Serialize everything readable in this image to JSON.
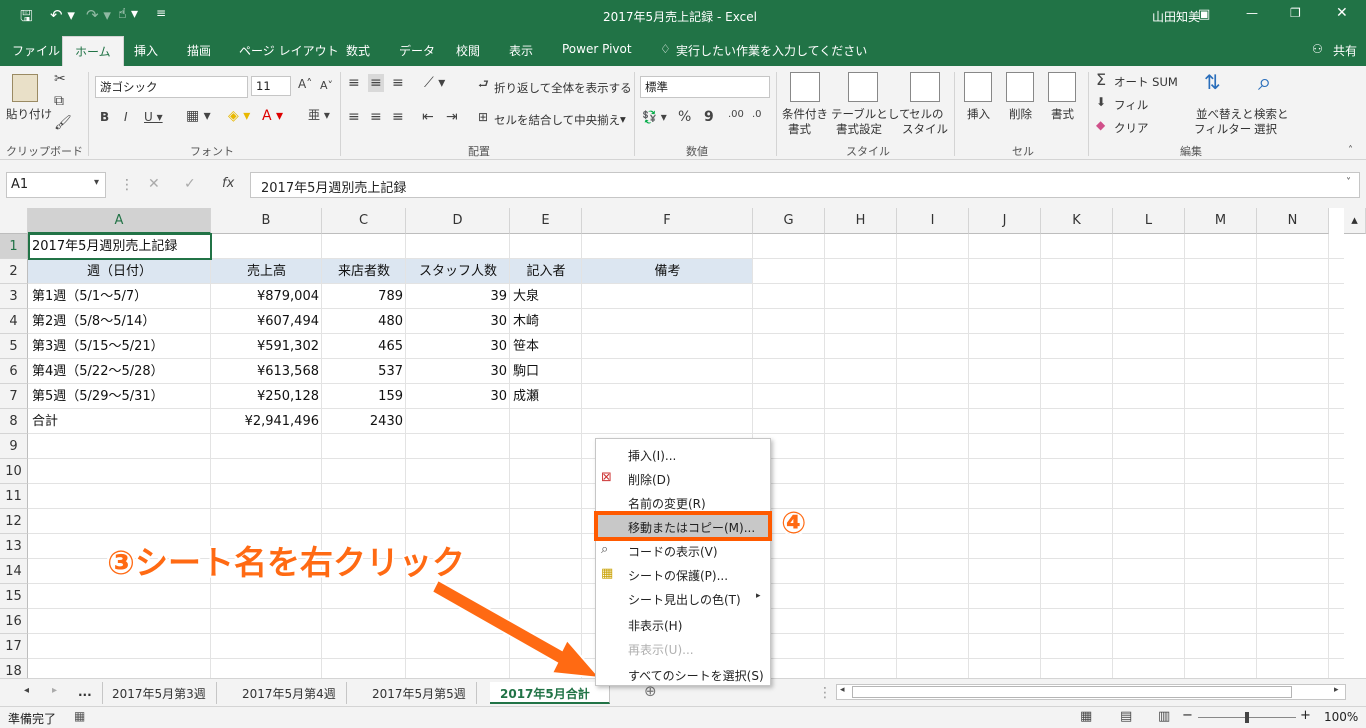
{
  "window": {
    "title": "2017年5月売上記録 - Excel",
    "user": "山田知美"
  },
  "menu_tabs": [
    "ファイル",
    "ホーム",
    "挿入",
    "描画",
    "ページ レイアウト",
    "数式",
    "データ",
    "校閲",
    "表示",
    "Power Pivot"
  ],
  "tell_me": "実行したい作業を入力してください",
  "share": "共有",
  "ribbon": {
    "paste": "貼り付け",
    "clipboard": "クリップボード",
    "font_name": "游ゴシック",
    "font_size": "11",
    "font": "フォント",
    "wrap": "折り返して全体を表示する",
    "merge": "セルを結合して中央揃え",
    "alignment": "配置",
    "number_format": "標準",
    "number": "数値",
    "cond": [
      "条件付き",
      "書式"
    ],
    "table": [
      "テーブルとして",
      "書式設定"
    ],
    "cellstyle": [
      "セルの",
      "スタイル"
    ],
    "styles": "スタイル",
    "insert": "挿入",
    "delete": "削除",
    "format": "書式",
    "cells": "セル",
    "autosum": "オート SUM",
    "fill": "フィル",
    "clear": "クリア",
    "sort": [
      "並べ替えと",
      "フィルター"
    ],
    "find": [
      "検索と",
      "選択"
    ],
    "editing": "編集"
  },
  "formula": {
    "namebox": "A1",
    "content": "2017年5月週別売上記録"
  },
  "columns": [
    "A",
    "B",
    "C",
    "D",
    "E",
    "F",
    "G",
    "H",
    "I",
    "J",
    "K",
    "L",
    "M",
    "N"
  ],
  "rows": [
    "1",
    "2",
    "3",
    "4",
    "5",
    "6",
    "7",
    "8",
    "9",
    "10",
    "11",
    "12",
    "13",
    "14",
    "15",
    "16",
    "17",
    "18"
  ],
  "sheet": {
    "a1": "2017年5月週別売上記録",
    "headers": [
      "週（日付）",
      "売上高",
      "来店者数",
      "スタッフ人数",
      "記入者",
      "備考"
    ],
    "data": [
      [
        "第1週（5/1～5/7）",
        "¥879,004",
        "789",
        "39",
        "大泉"
      ],
      [
        "第2週（5/8～5/14）",
        "¥607,494",
        "480",
        "30",
        "木崎"
      ],
      [
        "第3週（5/15～5/21）",
        "¥591,302",
        "465",
        "30",
        "笹本"
      ],
      [
        "第4週（5/22～5/28）",
        "¥613,568",
        "537",
        "30",
        "駒口"
      ],
      [
        "第5週（5/29～5/31）",
        "¥250,128",
        "159",
        "30",
        "成瀬"
      ]
    ],
    "total": [
      "合計",
      "¥2,941,496",
      "2430"
    ]
  },
  "context_menu": [
    {
      "label": "挿入(I)...",
      "disabled": false
    },
    {
      "label": "削除(D)",
      "disabled": false
    },
    {
      "label": "名前の変更(R)",
      "disabled": false
    },
    {
      "label": "移動またはコピー(M)...",
      "disabled": false
    },
    {
      "label": "コードの表示(V)",
      "disabled": false
    },
    {
      "label": "シートの保護(P)...",
      "disabled": false
    },
    {
      "label": "シート見出しの色(T)",
      "disabled": false
    },
    {
      "label": "非表示(H)",
      "disabled": false
    },
    {
      "label": "再表示(U)...",
      "disabled": true
    },
    {
      "label": "すべてのシートを選択(S)",
      "disabled": false
    }
  ],
  "sheet_tabs": [
    "...",
    "2017年5月第3週",
    "2017年5月第4週",
    "2017年5月第5週",
    "2017年5月合計"
  ],
  "status": {
    "ready": "準備完了",
    "zoom": "100%"
  },
  "annotations": {
    "step3": "③シート名を右クリック",
    "step4": "④"
  },
  "colors": {
    "excel_green": "#217346",
    "annotation": "#ff6a13",
    "header_fill": "#dce6f1"
  }
}
